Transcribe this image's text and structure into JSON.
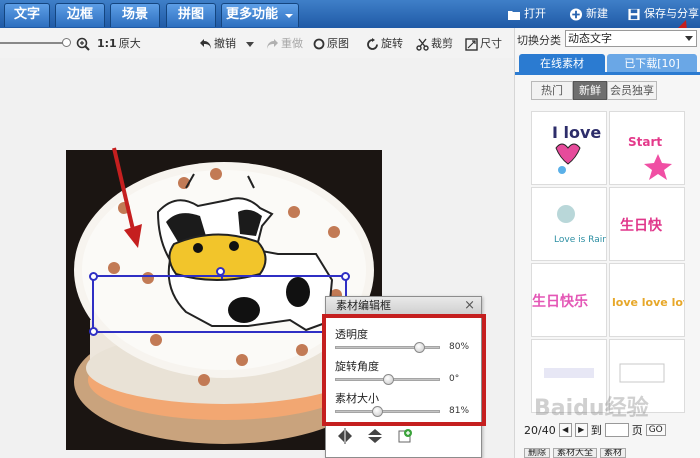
{
  "top_tabs": [
    "文字",
    "边框",
    "场景",
    "拼图",
    "更多功能"
  ],
  "top_actions": {
    "open": "打开",
    "new": "新建",
    "save_share": "保存与分享"
  },
  "toolbar": {
    "zoom_ratio": "1:1",
    "original_size": "原大",
    "undo": "撤销",
    "redo": "重做",
    "original_image": "原图",
    "rotate": "旋转",
    "crop": "裁剪",
    "size": "尺寸"
  },
  "right_panel": {
    "category_label": "切换分类",
    "category_value": "动态文字",
    "tabs": [
      "在线素材",
      "已下载[10]"
    ],
    "subtabs": [
      "热门",
      "新鲜",
      "会员独享"
    ],
    "thumbnails": [
      {
        "text": "I love U"
      },
      {
        "text": "Start"
      },
      {
        "text": "Love is Rain"
      },
      {
        "text": "生日快"
      },
      {
        "text": "生日快乐"
      },
      {
        "text": "love love love"
      },
      {
        "text": ""
      },
      {
        "text": ""
      }
    ],
    "pager": {
      "page": "20/40",
      "goto_label": "到",
      "page_unit": "页",
      "go_button": "GO"
    },
    "bottom_buttons": [
      "删除",
      "素材大全",
      "素材"
    ]
  },
  "dialog": {
    "title": "素材编辑框",
    "sliders": [
      {
        "label": "透明度",
        "value": 80,
        "display": "80%"
      },
      {
        "label": "旋转角度",
        "value": 50,
        "display": "0°"
      },
      {
        "label": "素材大小",
        "value": 40,
        "display": "81%"
      }
    ]
  },
  "watermark": "Baidu经验",
  "colors": {
    "accent": "#2b7bd1",
    "highlight": "#c51f1f",
    "topbar": "#2a65b0"
  }
}
